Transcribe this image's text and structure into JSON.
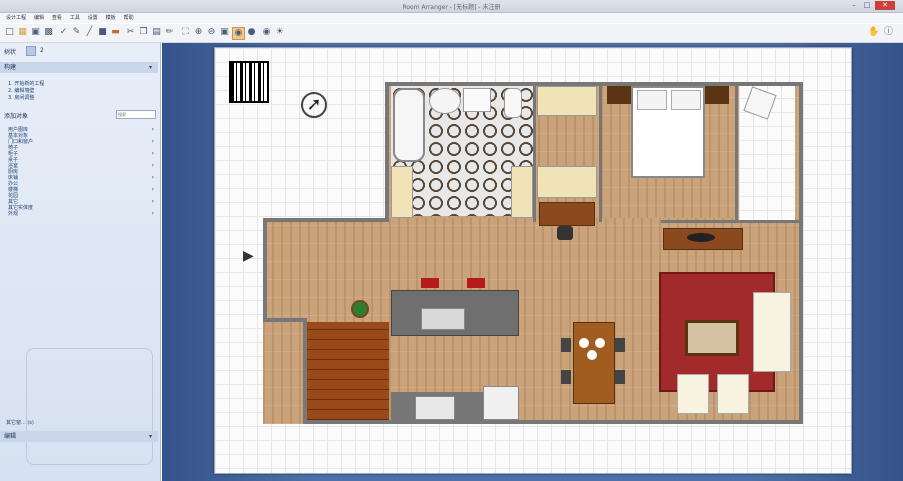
{
  "window": {
    "title": "Room Arranger - [无标题] - 未注册"
  },
  "menu": [
    "设计工程",
    "编辑",
    "查看",
    "工具",
    "设置",
    "模板",
    "帮助"
  ],
  "sidebar": {
    "header": "树状",
    "tab_count": "2",
    "section_build": "构建",
    "steps": [
      "1. 开始新的工程",
      "2. 编辑墙壁",
      "3. 房间调整"
    ],
    "add_objects": "添加对象",
    "search_placeholder": "搜索",
    "categories": [
      "用户图库",
      "基本对象",
      "门口和窗户",
      "椅子",
      "柜子",
      "桌子",
      "浴室",
      "厨房",
      "床铺",
      "办公",
      "楼梯",
      "花园",
      "其它",
      "其它实体度",
      "外观"
    ],
    "more_label": "其它窗... (s)",
    "edit_label": "编辑"
  }
}
